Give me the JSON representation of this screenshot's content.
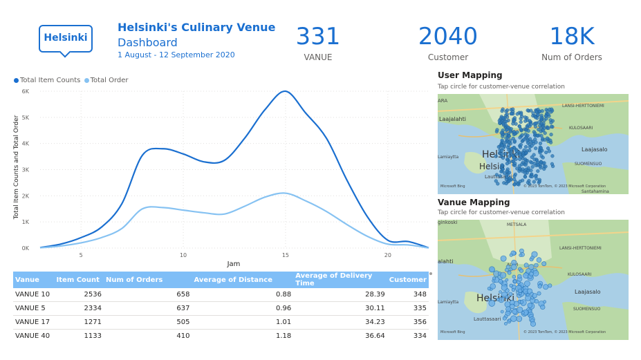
{
  "header": {
    "logo_text": "Helsinki",
    "title_line1": "Helsinki's Culinary Venue",
    "title_line2": "Dashboard",
    "date_range": "1 August - 12 September 2020"
  },
  "kpis": [
    {
      "value": "331",
      "label": "VANUE"
    },
    {
      "value": "2040",
      "label": "Customer"
    },
    {
      "value": "18K",
      "label": "Num of Orders"
    }
  ],
  "colors": {
    "accent": "#1a6fd0",
    "series1": "#1a6fd0",
    "series2": "#86c2f2",
    "table_header": "#7fbef7"
  },
  "chart_data": {
    "type": "line",
    "xlabel": "Jam",
    "ylabel": "Total Item Counts and Total Order",
    "ylim": [
      0,
      6000
    ],
    "xlim": [
      3,
      22
    ],
    "x_ticks": [
      5,
      10,
      15,
      20
    ],
    "y_ticks": [
      "0K",
      "1K",
      "2K",
      "3K",
      "4K",
      "5K",
      "6K"
    ],
    "legend_position": "top-left",
    "x": [
      3,
      4,
      5,
      6,
      7,
      8,
      9,
      10,
      11,
      12,
      13,
      14,
      15,
      16,
      17,
      18,
      19,
      20,
      21,
      22
    ],
    "series": [
      {
        "name": "Total Item Counts",
        "values": [
          20,
          150,
          400,
          800,
          1700,
          3550,
          3800,
          3600,
          3300,
          3350,
          4200,
          5300,
          6000,
          5150,
          4200,
          2600,
          1200,
          300,
          250,
          10
        ]
      },
      {
        "name": "Total Order",
        "values": [
          10,
          80,
          200,
          400,
          750,
          1500,
          1550,
          1450,
          1350,
          1300,
          1600,
          1950,
          2100,
          1800,
          1400,
          900,
          450,
          150,
          120,
          5
        ]
      }
    ]
  },
  "user_map": {
    "title": "User Mapping",
    "subtitle": "Tap circle for customer-venue correlation",
    "labels": [
      "ARA",
      "Laajalahti",
      "Helsinki",
      "Helsin",
      "Lauttasaari",
      "LANSI-HERTTONIEMI",
      "KULOSAARI",
      "Laajasalo",
      "SUOMENSUO",
      "Lamiaytta",
      "Santahamina"
    ],
    "attribution": "© 2023 TomTom, © 2023 Microsoft Corporation",
    "bing": "Microsoft Bing"
  },
  "venue_map": {
    "title": "Vanue Mapping",
    "subtitle": "Tap circle for customer-venue correlation",
    "labels": [
      "ginkoski",
      "METSALA",
      "LANSI-HERTTONIEMI",
      "ALPPI",
      "KULOSAARI",
      "alahti",
      "Laajasalo",
      "Helsinki",
      "SUOMENSUO",
      "Lauttasaari",
      "Lamiaytta"
    ],
    "attribution": "© 2023 TomTom, © 2023 Microsoft Corporation",
    "bing": "Microsoft Bing"
  },
  "table": {
    "columns": [
      "Vanue",
      "Item Count",
      "Num of Orders",
      "Average of Distance",
      "Average of Delivery Time",
      "Customer"
    ],
    "rows": [
      [
        "VANUE 10",
        "2536",
        "658",
        "0.88",
        "28.39",
        "348"
      ],
      [
        "VANUE 5",
        "2334",
        "637",
        "0.96",
        "30.11",
        "335"
      ],
      [
        "VANUE 17",
        "1271",
        "505",
        "1.01",
        "34.23",
        "356"
      ],
      [
        "VANUE 40",
        "1133",
        "410",
        "1.18",
        "36.64",
        "334"
      ]
    ]
  }
}
